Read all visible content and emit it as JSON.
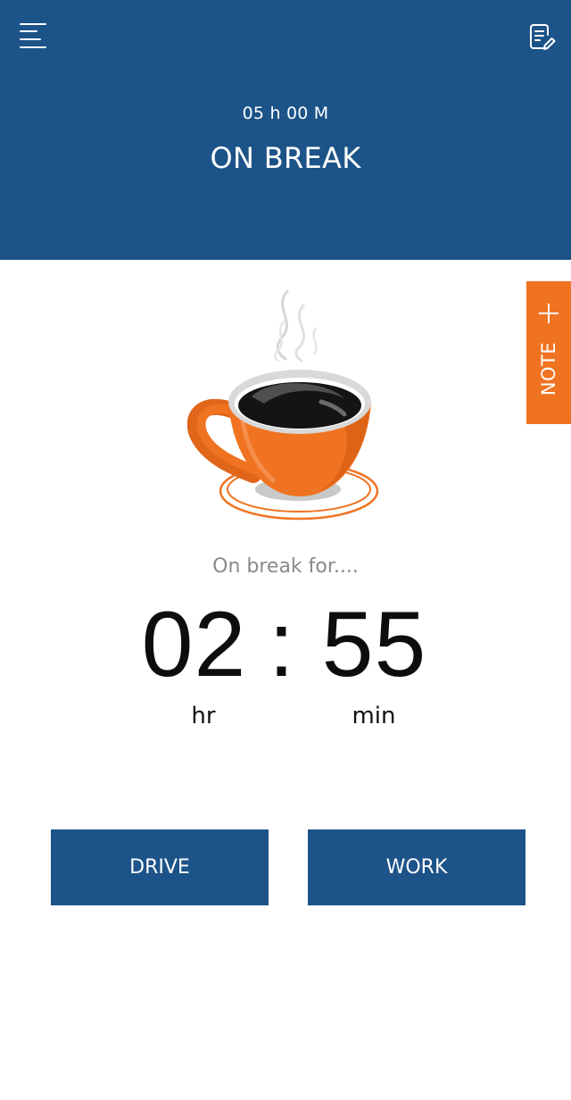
{
  "header": {
    "elapsed_total": "05 h 00 M",
    "status": "ON BREAK",
    "menu_icon": "hamburger-menu-icon",
    "log_icon": "document-edit-icon",
    "background_color": "#1c5388"
  },
  "note_tab": {
    "label": "NOTE",
    "icon": "plus-icon",
    "color": "#f07321"
  },
  "illustration": {
    "icon": "coffee-cup-icon",
    "cup_color": "#f07321"
  },
  "break_timer": {
    "label": "On break for....",
    "hours": "02",
    "separator": ":",
    "minutes": "55",
    "hours_unit": "hr",
    "minutes_unit": "min"
  },
  "actions": {
    "drive_label": "DRIVE",
    "work_label": "WORK",
    "button_color": "#1c5388"
  }
}
